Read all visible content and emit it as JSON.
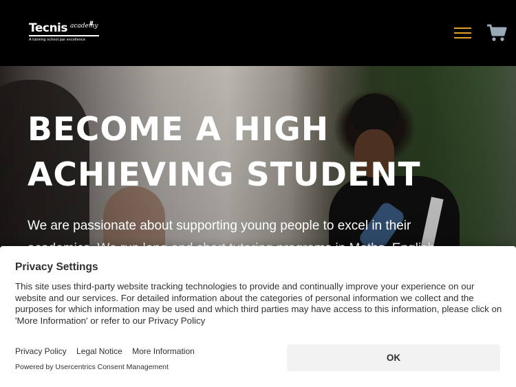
{
  "header": {
    "logo": {
      "name": "Tecnis",
      "accent": "academy",
      "slashes": "///",
      "tagline": "A tutoring school par excellence"
    },
    "menu_icon": "hamburger-menu-icon",
    "cart_icon": "shopping-cart-icon",
    "colors": {
      "background": "#000000",
      "menu_accent": "#e3a12a",
      "cart": "#9aa9b8"
    }
  },
  "hero": {
    "title": "BECOME A HIGH ACHIEVING STUDENT",
    "text": "We are passionate about supporting young people to excel in their academics. We run long and short tutoring programs in Maths, English"
  },
  "consent": {
    "title": "Privacy Settings",
    "body": "This site uses third-party website tracking technologies to provide and continually improve your experience on our website and our services. For detailed information about the categories of personal information we collect and the purposes for which information may be used and which third parties may have access to this information, please click on 'More Information' or refer to our Privacy Policy",
    "links": {
      "privacy_policy": "Privacy Policy",
      "legal_notice": "Legal Notice",
      "more_information": "More Information"
    },
    "powered_by": "Powered by Usercentrics Consent Management",
    "ok_label": "OK"
  }
}
